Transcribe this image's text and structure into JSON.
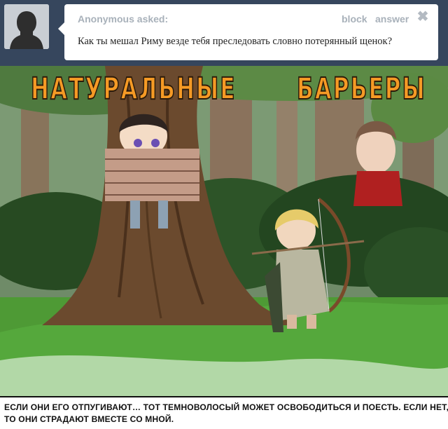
{
  "ask": {
    "asker": "Anonymous asked:",
    "actions": {
      "block": "block",
      "answer": "answer"
    },
    "close_symbol": "✖",
    "question": "Как ты мешал Риму везде тебя преследовать словно потерянный щенок?"
  },
  "comic": {
    "title_left": "НАТУРАЛЬНЫЕ",
    "title_right": "БАРЬЕРЫ"
  },
  "caption": {
    "line1": "ЕСЛИ ОНИ ЕГО ОТПУГИВАЮТ… ТОТ ТЕМНОВОЛОСЫЙ МОЖЕТ ОСВОБОДИТЬСЯ И ПОЕСТЬ. ЕСЛИ НЕТ,",
    "line2": "ТО ОНИ СТРАДАЮТ ВМЕСТЕ СО МНОЙ."
  },
  "colors": {
    "header_bg": "#36465d",
    "meta_text": "#a8b1ba",
    "title_orange": "#f59a25"
  },
  "icons": {
    "avatar": "anonymous-avatar-icon",
    "close": "close-icon"
  }
}
